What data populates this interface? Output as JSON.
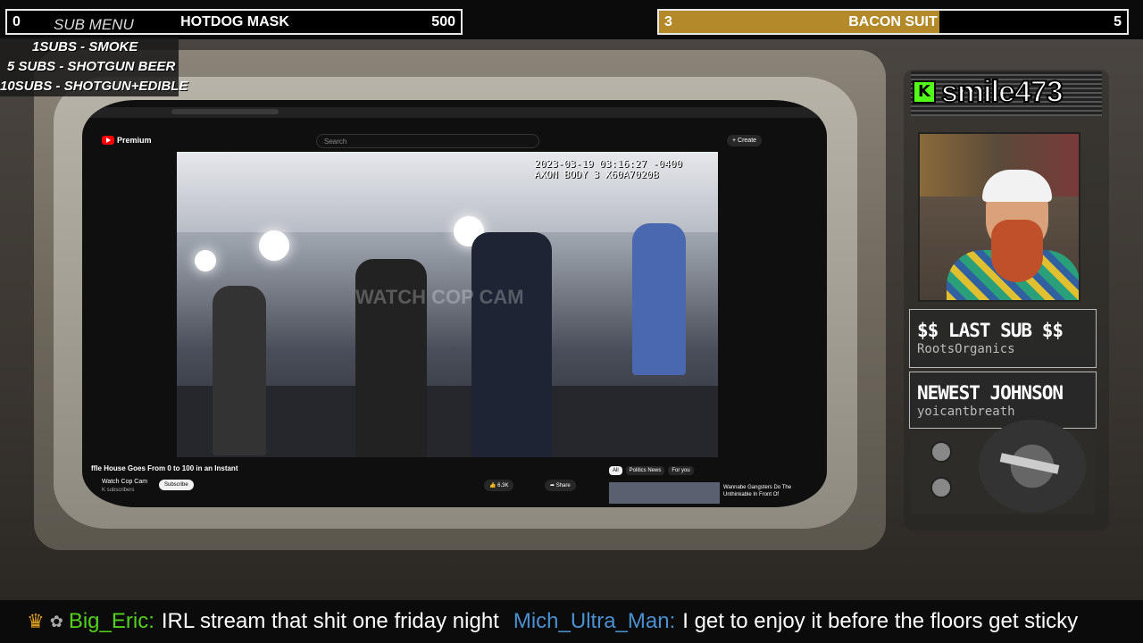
{
  "goals": {
    "left": {
      "start": "0",
      "title": "HOTDOG MASK",
      "end": "500",
      "progress_fraction": 0.0
    },
    "right": {
      "start": "3",
      "title": "BACON SUIT",
      "end": "5",
      "progress_fraction": 0.6
    }
  },
  "sub_menu": {
    "title": "SUB MENU",
    "items": [
      "1SUBS   - SMOKE",
      "5 SUBS  - SHOTGUN BEER",
      "10SUBS - SHOTGUN+EDIBLE"
    ]
  },
  "youtube": {
    "logo": "Premium",
    "search_placeholder": "Search",
    "create_label": "+ Create",
    "video_timestamp": "2023-03-19 03:16:27 -0400",
    "video_device": "AXON BODY 3 X60A7020B",
    "video_watermark": "WATCH COP CAM",
    "video_title": "ffle House Goes From 0 to 100 in an Instant",
    "channel": "Watch Cop Cam",
    "subscribers": "K subscribers",
    "subscribe_label": "Subscribe",
    "likes": "6.3K",
    "share_label": "Share",
    "chips": [
      "All",
      "Politics News",
      "For you"
    ],
    "rec_title": "Wannabe Gangsters Do The Unthinkable In Front Of"
  },
  "channel": {
    "platform_icon": "kick-icon",
    "icon_letter": "K",
    "name": "smile473"
  },
  "last_sub": {
    "label": "$$ LAST SUB $$",
    "value": "RootsOrganics"
  },
  "newest": {
    "label": "NEWEST JOHNSON",
    "value": "yoicantbreath"
  },
  "chat": {
    "messages": [
      {
        "user": "Big_Eric:",
        "text": "IRL stream that shit one friday night"
      },
      {
        "user": "Mich_Ultra_Man:",
        "text": "I get to enjoy it before the floors get sticky"
      }
    ]
  },
  "colors": {
    "goal_fill": "#b3892a",
    "kick_green": "#53fc18",
    "chat_user1": "#53d01c",
    "chat_user2": "#4a90d0"
  }
}
